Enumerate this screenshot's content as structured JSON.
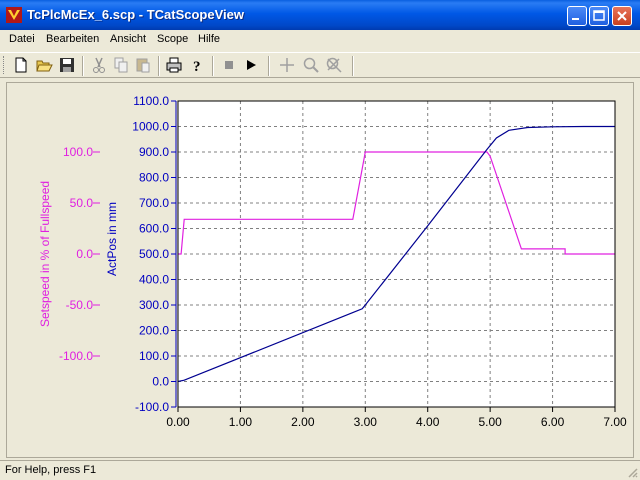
{
  "window": {
    "title": "TcPlcMcEx_6.scp - TCatScopeView"
  },
  "menu": [
    "Datei",
    "Bearbeiten",
    "Ansicht",
    "Scope",
    "Hilfe"
  ],
  "toolbar_icons": [
    "new-file-icon",
    "open-folder-icon",
    "save-icon",
    "cut-icon",
    "copy-icon",
    "paste-icon",
    "print-icon",
    "help-icon",
    "stop-icon",
    "play-icon",
    "crosshair-icon",
    "zoom-icon",
    "zoom-reset-icon"
  ],
  "status": {
    "text": "For Help, press F1"
  },
  "colors": {
    "setspeed": "#e020e0",
    "actpos": "#000090",
    "grid": "#808080",
    "axis_blue": "#0000c0"
  },
  "chart_data": {
    "type": "line",
    "title": "",
    "xlabel": "",
    "xlim": [
      0,
      7
    ],
    "x_ticks": [
      "0.00",
      "1.00",
      "2.00",
      "3.00",
      "4.00",
      "5.00",
      "6.00",
      "7.00"
    ],
    "y_axes": [
      {
        "id": "setspeed",
        "label": "Setspeed in % of Fullspeed",
        "ylim": [
          -150,
          150
        ],
        "ticks": [
          "100.0",
          "50.0",
          "0.0",
          "-50.0",
          "-100.0"
        ],
        "tick_values": [
          100,
          50,
          0,
          -50,
          -100
        ]
      },
      {
        "id": "actpos",
        "label": "ActPos in mm",
        "ylim": [
          -100,
          1100
        ],
        "ticks": [
          "1100.0",
          "1000.0",
          "900.0",
          "800.0",
          "700.0",
          "600.0",
          "500.0",
          "400.0",
          "300.0",
          "200.0",
          "100.0",
          "0.0",
          "-100.0"
        ],
        "tick_values": [
          1100,
          1000,
          900,
          800,
          700,
          600,
          500,
          400,
          300,
          200,
          100,
          0,
          -100
        ]
      }
    ],
    "grid": true,
    "series": [
      {
        "name": "Setspeed in % of Fullspeed",
        "axis": "setspeed",
        "x": [
          0,
          0.05,
          0.1,
          2.8,
          2.8,
          3.0,
          3.0,
          4.95,
          5.0,
          5.5,
          5.55,
          6.2,
          6.2,
          7.0
        ],
        "y": [
          0,
          0,
          34,
          34,
          34,
          100,
          100,
          100,
          96,
          5,
          5,
          5,
          0,
          0
        ]
      },
      {
        "name": "ActPos in mm",
        "axis": "actpos",
        "x": [
          0,
          0.1,
          2.8,
          2.95,
          3.0,
          4.0,
          4.95,
          5.1,
          5.3,
          5.6,
          6.0,
          6.5,
          7.0
        ],
        "y": [
          0,
          5,
          270,
          285,
          300,
          610,
          910,
          955,
          985,
          996,
          999,
          1000,
          1000
        ]
      }
    ]
  }
}
